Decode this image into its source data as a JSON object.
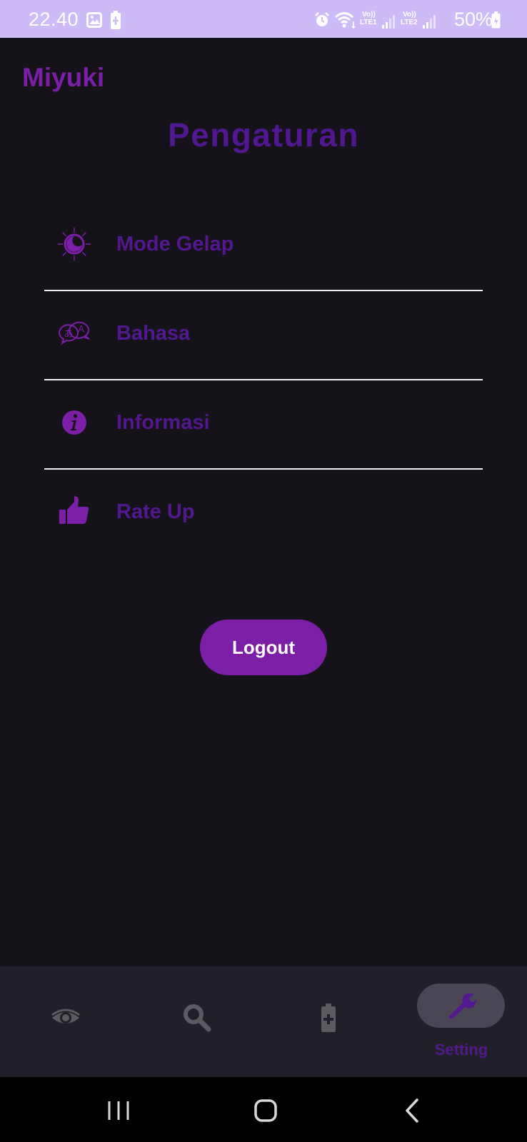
{
  "status_bar": {
    "time": "22.40",
    "battery_percent": "50%",
    "sim1": "LTE1",
    "sim2": "LTE2",
    "volte_label": "Vo))",
    "icons": [
      "gallery-icon",
      "battery-saver-icon",
      "alarm-icon",
      "wifi-icon",
      "signal-icon",
      "battery-icon"
    ]
  },
  "header": {
    "app_name": "Miyuki",
    "page_title": "Pengaturan"
  },
  "settings": {
    "items": [
      {
        "label": "Mode Gelap",
        "icon": "dark-mode-icon"
      },
      {
        "label": "Bahasa",
        "icon": "translate-icon"
      },
      {
        "label": "Informasi",
        "icon": "info-icon"
      },
      {
        "label": "Rate Up",
        "icon": "thumbs-up-icon"
      }
    ]
  },
  "logout": {
    "label": "Logout"
  },
  "bottom_nav": {
    "items": [
      {
        "icon": "eye-icon",
        "active": false
      },
      {
        "icon": "search-icon",
        "active": false
      },
      {
        "icon": "battery-plus-icon",
        "active": false
      },
      {
        "icon": "wrench-icon",
        "label": "Setting",
        "active": true
      }
    ]
  },
  "system_nav": {
    "buttons": [
      "recent-apps",
      "home",
      "back"
    ]
  },
  "colors": {
    "accent": "#7a1fa6",
    "accent_dark": "#52188f",
    "background": "#151319",
    "status_bar": "#cdbbf8",
    "nav_background": "#211f27"
  }
}
